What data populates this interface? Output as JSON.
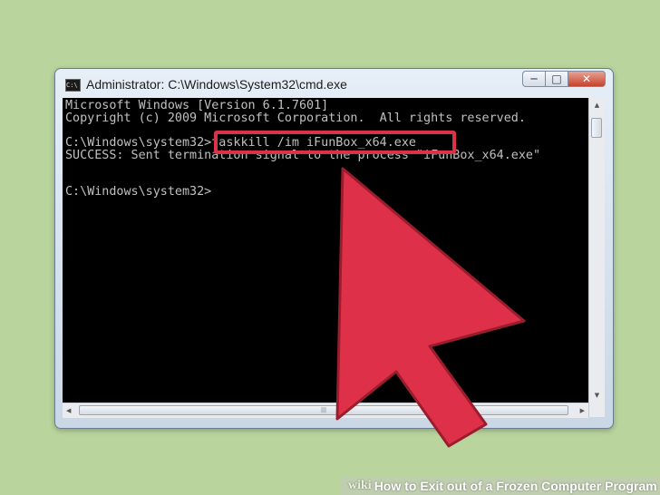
{
  "window": {
    "title": "Administrator: C:\\Windows\\System32\\cmd.exe",
    "buttons": {
      "minimize": "─",
      "maximize": "□",
      "close": "✕"
    }
  },
  "console": {
    "lines": [
      "Microsoft Windows [Version 6.1.7601]",
      "Copyright (c) 2009 Microsoft Corporation.  All rights reserved.",
      "",
      "C:\\Windows\\system32>taskkill /im iFunBox_x64.exe",
      "SUCCESS: Sent termination signal to the process \"iFunBox_x64.exe\"",
      "",
      "",
      "C:\\Windows\\system32>"
    ]
  },
  "footer": {
    "brand": "wiki",
    "how": "How",
    "rest": "to Exit out of a Frozen Computer Program"
  },
  "colors": {
    "background": "#b9d49d",
    "console_bg": "#000000",
    "console_text": "#c0c0c0",
    "highlight": "#d9334a"
  },
  "icons": [
    "cmd-icon",
    "minimize-icon",
    "maximize-icon",
    "close-icon",
    "pointer-arrow-icon"
  ]
}
